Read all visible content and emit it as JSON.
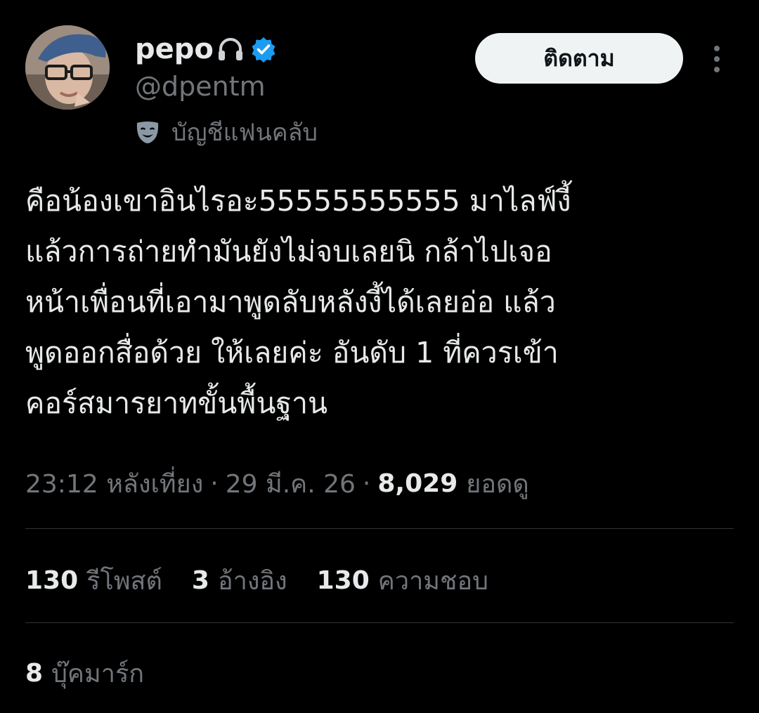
{
  "user": {
    "display_name": "pepo",
    "handle": "@dpentm",
    "fanclub_label": "บัญชีแฟนคลับ",
    "name_emoji_icon": "headphone-icon",
    "verified_icon": "verified-badge-icon",
    "fanclub_icon": "mask-icon"
  },
  "actions": {
    "follow_label": "ติดตาม",
    "more_icon": "more-vertical-icon"
  },
  "tweet": {
    "lines": [
      "คือน้องเขาอินไรอะ55555555555 มาไลฟ์งี้",
      "แล้วการถ่ายทำมันยังไม่จบเลยนิ กล้าไปเจอ",
      "หน้าเพื่อนที่เอามาพูดลับหลังงี้ได้เลยอ่อ แล้ว",
      "พูดออกสื่อด้วย ให้เลยค่ะ อันดับ 1 ที่ควรเข้า",
      "คอร์สมารยาทขั้นพื้นฐาน"
    ]
  },
  "meta": {
    "time": "23:12 หลังเที่ยง",
    "separator": "·",
    "date": "29 มี.ค. 26",
    "views_count": "8,029",
    "views_label": "ยอดดู"
  },
  "stats": {
    "reposts_count": "130",
    "reposts_label": "รีโพสต์",
    "quotes_count": "3",
    "quotes_label": "อ้างอิง",
    "likes_count": "130",
    "likes_label": "ความชอบ",
    "bookmarks_count": "8",
    "bookmarks_label": "บุ๊คมาร์ก"
  },
  "colors": {
    "background": "#000000",
    "primary_text": "#e7e9ea",
    "secondary_text": "#71767b",
    "verified_blue": "#1d9bf0",
    "divider": "#2f3336",
    "follow_button_bg": "#eff3f4"
  }
}
